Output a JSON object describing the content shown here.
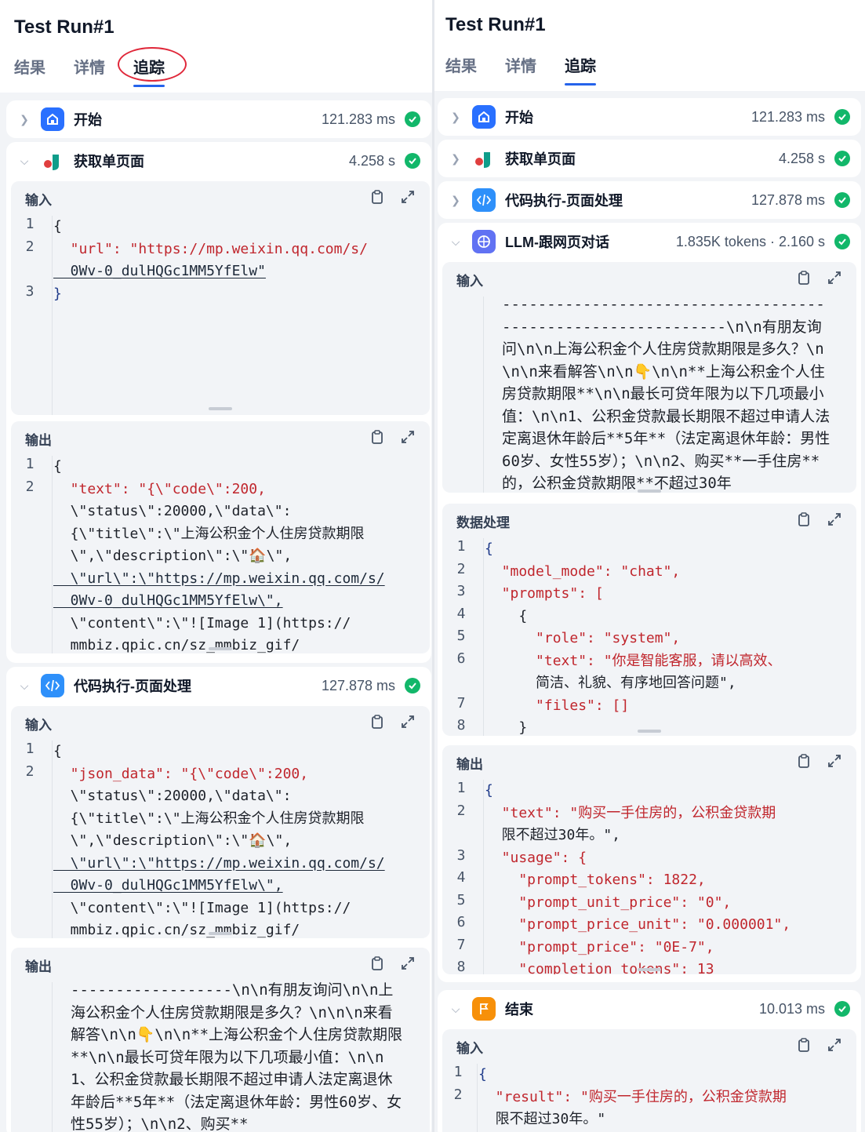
{
  "title": "Test Run#1",
  "tabs": [
    "结果",
    "详情",
    "追踪"
  ],
  "colors": {
    "accent": "#2563eb",
    "success": "#12b76a",
    "highlight_circle": "#e0283a"
  },
  "labels": {
    "input": "输入",
    "output": "输出",
    "data_processing": "数据处理"
  },
  "nodes": {
    "start": {
      "name": "开始",
      "time": "121.283 ms",
      "icon": "home-icon"
    },
    "fetch": {
      "name": "获取单页面",
      "time": "4.258 s",
      "icon": "tool-logo-icon"
    },
    "code": {
      "name": "代码执行-页面处理",
      "time": "127.878 ms",
      "icon": "code-icon"
    },
    "llm": {
      "name": "LLM-跟网页对话",
      "time": "1.835K tokens · 2.160 s",
      "icon": "llm-icon"
    },
    "end": {
      "name": "结束",
      "time": "10.013 ms",
      "icon": "end-icon"
    }
  },
  "code_blocks": {
    "fetch_input": {
      "line_numbers": [
        "1",
        "2",
        "",
        "3"
      ],
      "lines": [
        "{",
        "  \"url\": \"https://mp.weixin.qq.com/s/",
        "  0Wv-0_dulHQGc1MM5YfElw\"",
        "}"
      ]
    },
    "fetch_output": {
      "line_numbers": [
        "1",
        "2"
      ],
      "lines": [
        "{",
        "  \"text\": \"{\\\"code\\\":200,",
        "  \\\"status\\\":20000,\\\"data\\\":",
        "  {\\\"title\\\":\\\"上海公积金个人住房贷款期限",
        "  \\\",\\\"description\\\":\\\"🏠\\\",",
        "  \\\"url\\\":\\\"https://mp.weixin.qq.com/s/",
        "  0Wv-0_dulHQGc1MM5YfElw\\\",",
        "  \\\"content\\\":\\\"![Image 1](https://",
        "  mmbiz.qpic.cn/sz_mmbiz_gif/"
      ]
    },
    "code_input": {
      "line_numbers": [
        "1",
        "2"
      ],
      "lines": [
        "{",
        "  \"json_data\": \"{\\\"code\\\":200,",
        "  \\\"status\\\":20000,\\\"data\\\":",
        "  {\\\"title\\\":\\\"上海公积金个人住房贷款期限",
        "  \\\",\\\"description\\\":\\\"🏠\\\",",
        "  \\\"url\\\":\\\"https://mp.weixin.qq.com/s/",
        "  0Wv-0_dulHQGc1MM5YfElw\\\",",
        "  \\\"content\\\":\\\"![Image 1](https://",
        "  mmbiz.qpic.cn/sz_mmbiz_gif/"
      ]
    },
    "code_output_text": "------------------\\n\\n有朋友询问\\n\\n上海公积金个人住房贷款期限是多久？\\n\\n\\n来看解答\\n\\n👇\\n\\n**上海公积金个人住房贷款期限**\\n\\n最长可贷年限为以下几项最小值：\\n\\n1、公积金贷款最长期限不超过申请人法定离退休年龄后**5年**（法定离退休年龄：男性60岁、女性55岁）；\\n\\n2、购买**",
    "llm_input_text": "-------------------------------------------------------------\\n\\n有朋友询问\\n\\n上海公积金个人住房贷款期限是多久？\\n\\n\\n来看解答\\n\\n👇\\n\\n**上海公积金个人住房贷款期限**\\n\\n最长可贷年限为以下几项最小值：\\n\\n1、公积金贷款最长期限不超过申请人法定离退休年龄后**5年**（法定离退休年龄：男性60岁、女性55岁）；\\n\\n2、购买**一手住房**的，公积金贷款期限**不超过30年",
    "llm_data": {
      "line_numbers": [
        "1",
        "2",
        "3",
        "4",
        "5",
        "6",
        "",
        "7",
        "8"
      ],
      "lines": [
        "{",
        "  \"model_mode\": \"chat\",",
        "  \"prompts\": [",
        "    {",
        "      \"role\": \"system\",",
        "      \"text\": \"你是智能客服，请以高效、",
        "      简洁、礼貌、有序地回答问题\",",
        "      \"files\": []",
        "    }"
      ]
    },
    "llm_output": {
      "line_numbers": [
        "1",
        "2",
        "",
        "3",
        "4",
        "5",
        "6",
        "7",
        "8"
      ],
      "lines": [
        "{",
        "  \"text\": \"购买一手住房的，公积金贷款期",
        "  限不超过30年。\",",
        "  \"usage\": {",
        "    \"prompt_tokens\": 1822,",
        "    \"prompt_unit_price\": \"0\",",
        "    \"prompt_price_unit\": \"0.000001\",",
        "    \"prompt_price\": \"0E-7\",",
        "    \"completion_tokens\": 13"
      ]
    },
    "end_input": {
      "line_numbers": [
        "1",
        "2",
        ""
      ],
      "lines": [
        "{",
        "  \"result\": \"购买一手住房的，公积金贷款期",
        "  限不超过30年。\""
      ]
    }
  }
}
